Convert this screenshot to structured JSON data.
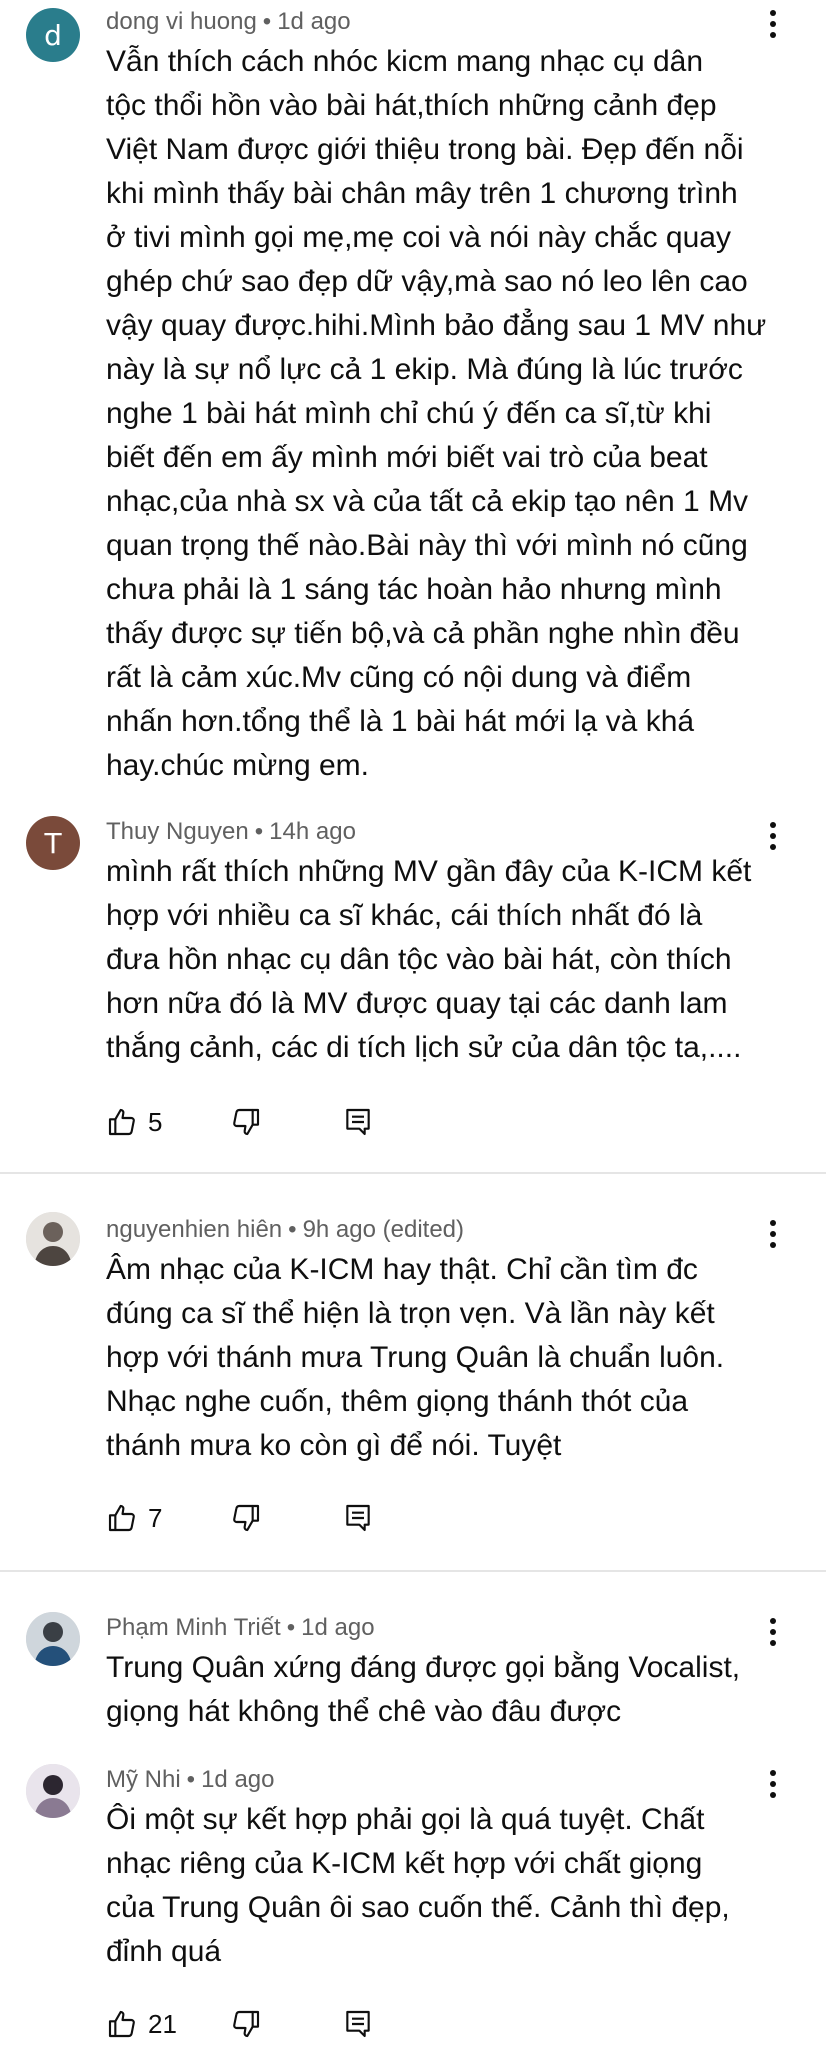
{
  "comments": [
    {
      "author": "dong vi huong",
      "time": "1d ago",
      "avatar_letter": "d",
      "lines": [
        "Vẫn thích cách nhóc kicm mang nhạc cụ dân",
        "tộc thổi hồn vào bài hát,thích những cảnh đẹp",
        "Việt Nam được giới thiệu trong bài. Đẹp đến nỗi",
        "khi mình thấy bài chân mây trên 1 chương trình",
        "ở tivi mình gọi mẹ,mẹ coi và nói này chắc quay",
        "ghép chứ sao đẹp dữ vậy,mà sao nó leo lên cao",
        "vậy quay được.hihi.Mình bảo đẳng sau 1 MV như",
        "này là sự nổ lực cả 1 ekip. Mà đúng là lúc trước",
        "nghe 1 bài hát mình chỉ chú ý đến ca sĩ,từ khi",
        "biết đến em ấy mình mới biết vai trò của beat",
        "nhạc,của nhà sx và của tất cả ekip tạo nên 1 Mv",
        "quan trọng thế nào.Bài này thì với mình nó cũng",
        "chưa phải là 1 sáng tác hoàn hảo nhưng mình",
        "thấy được sự tiến bộ,và cả phần nghe nhìn đều",
        "rất là cảm xúc.Mv cũng có nội dung và điểm",
        "nhấn hơn.tổng thể là 1 bài hát mới lạ và khá",
        "hay.chúc mừng em."
      ]
    },
    {
      "author": "Thuy Nguyen",
      "time": "14h ago",
      "avatar_letter": "T",
      "lines": [
        "mình rất thích những MV gần đây của K-ICM kết",
        "hợp với nhiều ca sĩ khác, cái thích nhất đó là",
        "đưa hồn nhạc cụ dân tộc vào bài hát, còn thích",
        "hơn nữa đó là MV được quay tại các danh lam",
        "thắng cảnh, các di tích lịch sử của dân tộc ta,...."
      ],
      "likes": "5"
    },
    {
      "author": "nguyenhien hiên",
      "time": "9h ago (edited)",
      "lines": [
        "Âm nhạc của K-ICM hay thật. Chỉ cần tìm đc",
        "đúng ca sĩ thể hiện là trọn vẹn. Và lần này kết",
        "hợp với thánh mưa Trung Quân là chuẩn luôn.",
        "Nhạc nghe cuốn, thêm giọng thánh thót của",
        "thánh mưa ko còn gì để nói. Tuyệt"
      ],
      "likes": "7"
    },
    {
      "author": "Phạm Minh Triết",
      "time": "1d ago",
      "lines": [
        "Trung Quân xứng đáng được gọi bằng Vocalist,",
        "giọng hát không thể chê vào đâu được"
      ]
    },
    {
      "author": "Mỹ Nhi",
      "time": "1d ago",
      "lines": [
        "Ôi một sự kết hợp phải gọi là quá tuyệt. Chất",
        "nhạc riêng của K-ICM kết hợp với chất giọng",
        "của Trung Quân ôi sao cuốn thế. Cảnh thì đẹp,",
        "đỉnh quá"
      ],
      "likes": "21"
    }
  ],
  "separator": "•",
  "icons": {
    "like": "thumb-up-icon",
    "dislike": "thumb-down-icon",
    "reply": "reply-comment-icon",
    "menu": "more-vertical-icon"
  },
  "colors": {
    "text": "#0f0f0f",
    "meta": "#606060",
    "divider": "#e5e5e5",
    "avatar_d": "#2a7d8c",
    "avatar_t": "#7a4a3a"
  }
}
